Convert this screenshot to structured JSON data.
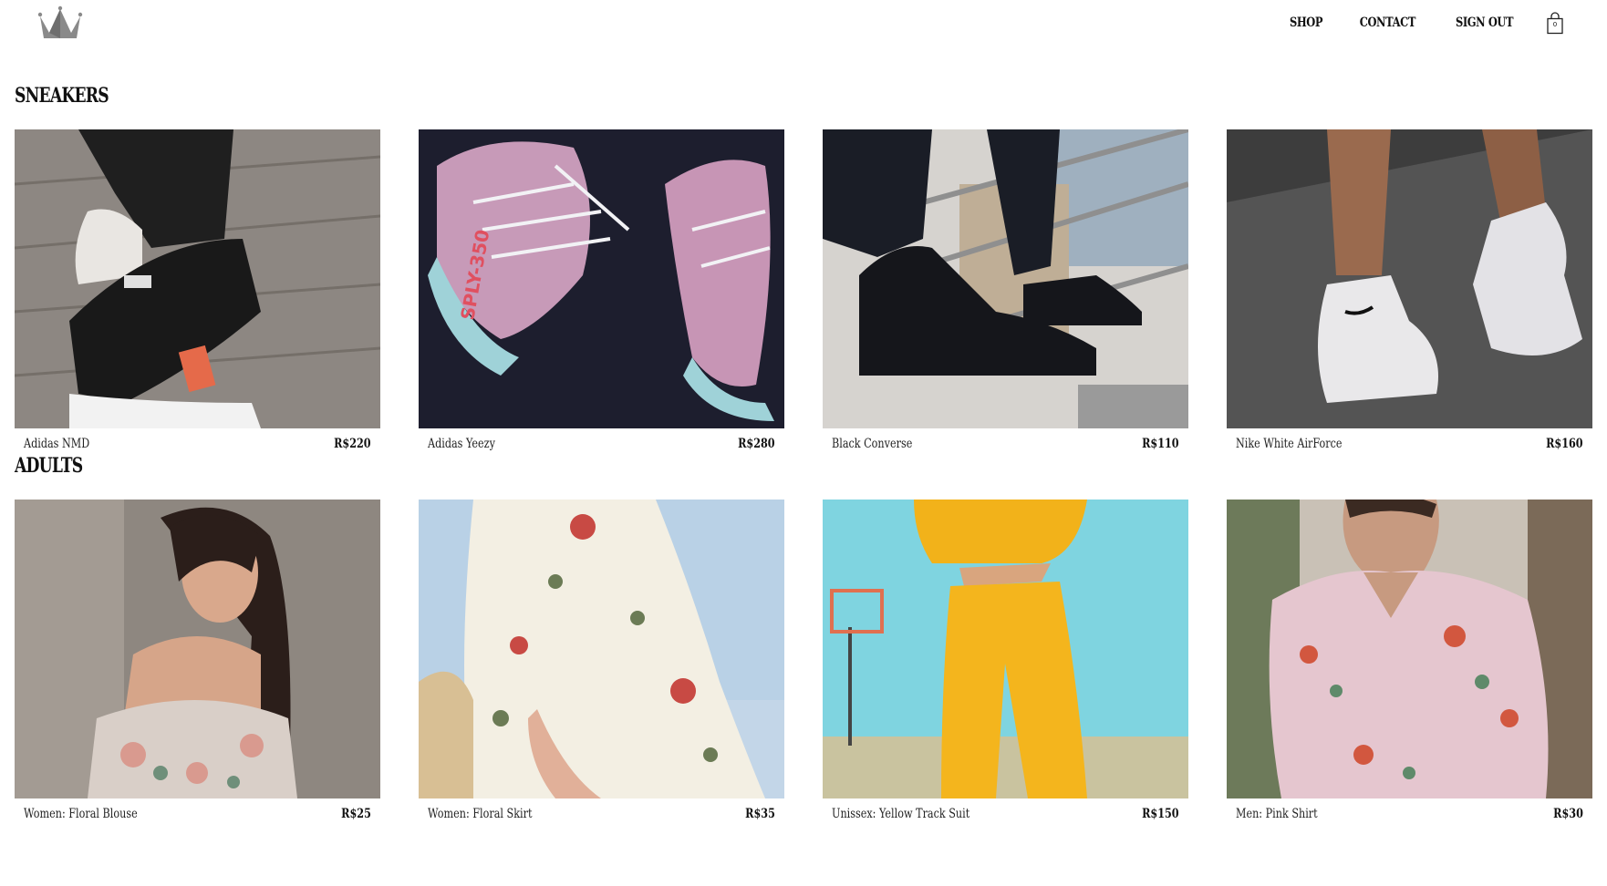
{
  "header": {
    "nav": [
      "SHOP",
      "CONTACT",
      "SIGN OUT"
    ],
    "cart_count": "0",
    "icons": {
      "logo": "crown-logo-icon",
      "cart": "shopping-bag-icon"
    }
  },
  "sections": [
    {
      "title": "SNEAKERS",
      "items": [
        {
          "name": "Adidas NMD",
          "price": "R$220",
          "image": "sneaker-adidas-nmd-photo"
        },
        {
          "name": "Adidas Yeezy",
          "price": "R$280",
          "image": "sneaker-adidas-yeezy-photo"
        },
        {
          "name": "Black Converse",
          "price": "R$110",
          "image": "sneaker-black-converse-photo"
        },
        {
          "name": "Nike White AirForce",
          "price": "R$160",
          "image": "sneaker-nike-airforce-photo"
        }
      ]
    },
    {
      "title": "ADULTS",
      "items": [
        {
          "name": "Women: Floral Blouse",
          "price": "R$25",
          "image": "woman-floral-blouse-photo"
        },
        {
          "name": "Women: Floral Skirt",
          "price": "R$35",
          "image": "woman-floral-skirt-photo"
        },
        {
          "name": "Unissex: Yellow Track Suit",
          "price": "R$150",
          "image": "yellow-track-suit-photo"
        },
        {
          "name": "Men: Pink Shirt",
          "price": "R$30",
          "image": "man-pink-shirt-photo"
        }
      ]
    }
  ],
  "colors": {
    "background": "#ffffff",
    "text": "#111111",
    "logo": "#7a7a7a"
  }
}
